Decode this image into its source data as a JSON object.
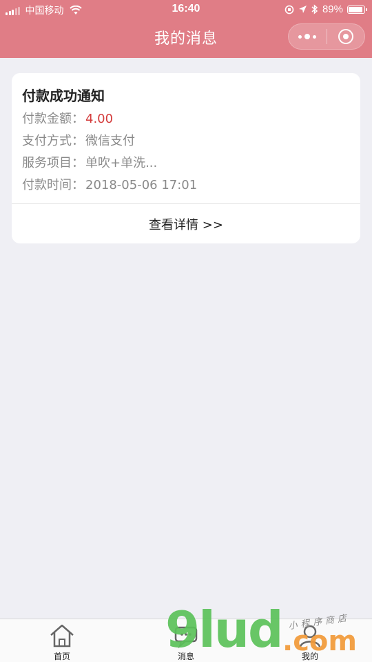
{
  "status_bar": {
    "carrier": "中国移动",
    "time": "16:40",
    "battery": "89%",
    "battery_level": 0.89
  },
  "nav": {
    "title": "我的消息"
  },
  "card": {
    "title": "付款成功通知",
    "rows": [
      {
        "label": "付款金额：",
        "value": "4.00"
      },
      {
        "label": "支付方式：",
        "value": "微信支付"
      },
      {
        "label": "服务项目：",
        "value": "单吹+单洗..."
      },
      {
        "label": "付款时间：",
        "value": "2018-05-06 17:01"
      }
    ],
    "detail_link": "查看详情 >>"
  },
  "tabbar": {
    "tabs": [
      {
        "label": "首页",
        "icon": "home-icon"
      },
      {
        "label": "消息",
        "icon": "chat-icon"
      },
      {
        "label": "我的",
        "icon": "user-icon"
      }
    ]
  },
  "watermark": {
    "brand": "9lud",
    "suffix": ".com",
    "tagline": "小程序商店"
  },
  "colors": {
    "header": "#e07d86",
    "amount": "#d43c3c",
    "background": "#efeff4"
  }
}
